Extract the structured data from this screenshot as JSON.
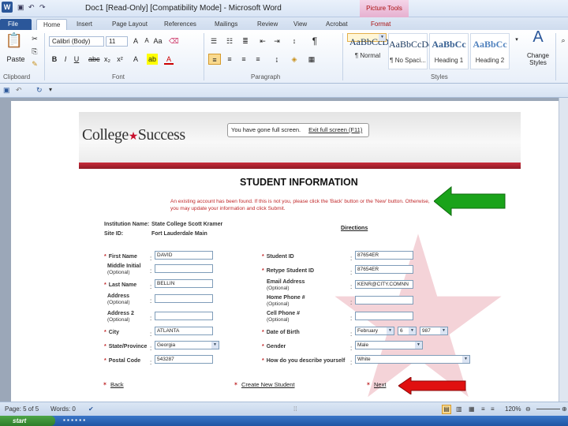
{
  "window": {
    "app_icon": "W",
    "title": "Doc1 [Read-Only] [Compatibility Mode] - Microsoft Word",
    "context_tools": "Picture Tools"
  },
  "tabs": [
    "File",
    "Home",
    "Insert",
    "Page Layout",
    "References",
    "Mailings",
    "Review",
    "View",
    "Acrobat",
    "Format"
  ],
  "ribbon": {
    "paste_label": "Paste",
    "font_name": "Calibri (Body)",
    "font_size": "11",
    "groups": {
      "clipboard": "Clipboard",
      "font": "Font",
      "paragraph": "Paragraph",
      "styles": "Styles"
    },
    "styles": [
      {
        "sample": "AaBbCcDc",
        "name": "¶ Normal"
      },
      {
        "sample": "AaBbCcDc",
        "name": "¶ No Spaci..."
      },
      {
        "sample": "AaBbCc",
        "name": "Heading 1"
      },
      {
        "sample": "AaBbCc",
        "name": "Heading 2"
      }
    ],
    "change_styles": "Change Styles"
  },
  "screenshot": {
    "logo_text": "College",
    "logo_text2": "Success",
    "fullscreen_msg": "You have gone full screen.",
    "exit_fullscreen": "Exit full screen (F11)",
    "heading": "STUDENT INFORMATION",
    "notice": "An existing account has been found. If this is not you, please click the 'Back' button or the 'New' button. Otherwise, you may update your information and click Submit.",
    "institution_label": "Institution Name:",
    "institution_value": "State College Scott Kramer",
    "site_label": "Site ID:",
    "site_value": "Fort Lauderdale Main",
    "directions": "Directions",
    "left_fields": {
      "first_name": {
        "label": "First Name",
        "value": "DAVID"
      },
      "middle_initial": {
        "label": "Middle Initial",
        "opt": "(Optional)",
        "value": ""
      },
      "last_name": {
        "label": "Last Name",
        "value": "BELLIN"
      },
      "address": {
        "label": "Address",
        "opt": "(Optional)",
        "value": ""
      },
      "address2": {
        "label": "Address 2",
        "opt": "(Optional)",
        "value": ""
      },
      "city": {
        "label": "City",
        "value": "ATLANTA"
      },
      "state": {
        "label": "State/Province",
        "value": "Georgia"
      },
      "postal": {
        "label": "Postal Code",
        "value": "543287"
      }
    },
    "right_fields": {
      "student_id": {
        "label": "Student ID",
        "value": "87654ER"
      },
      "retype_id": {
        "label": "Retype Student ID",
        "value": "87654ER"
      },
      "email": {
        "label": "Email Address",
        "opt": "(Optional)",
        "value": "KENR@CITY.COMNN"
      },
      "home_phone": {
        "label": "Home Phone #",
        "opt": "(Optional)",
        "value": ""
      },
      "cell_phone": {
        "label": "Cell Phone #",
        "opt": "(Optional)",
        "value": ""
      },
      "dob": {
        "label": "Date of Birth",
        "month": "February",
        "day": "6",
        "year": "987"
      },
      "gender": {
        "label": "Gender",
        "value": "Male"
      },
      "describe": {
        "label": "How do you describe yourself",
        "value": "White"
      }
    },
    "nav": {
      "back": "Back",
      "create_new": "Create New Student",
      "next": "Next"
    }
  },
  "status": {
    "page": "Page: 5 of 5",
    "words": "Words: 0",
    "zoom": "120%"
  },
  "taskbar": {
    "start": "start"
  },
  "colors": {
    "word_blue": "#2b579a",
    "college_red": "#c8102e",
    "notice_red": "#c0282a",
    "arrow_green": "#1aa31a",
    "arrow_red": "#e01010"
  }
}
